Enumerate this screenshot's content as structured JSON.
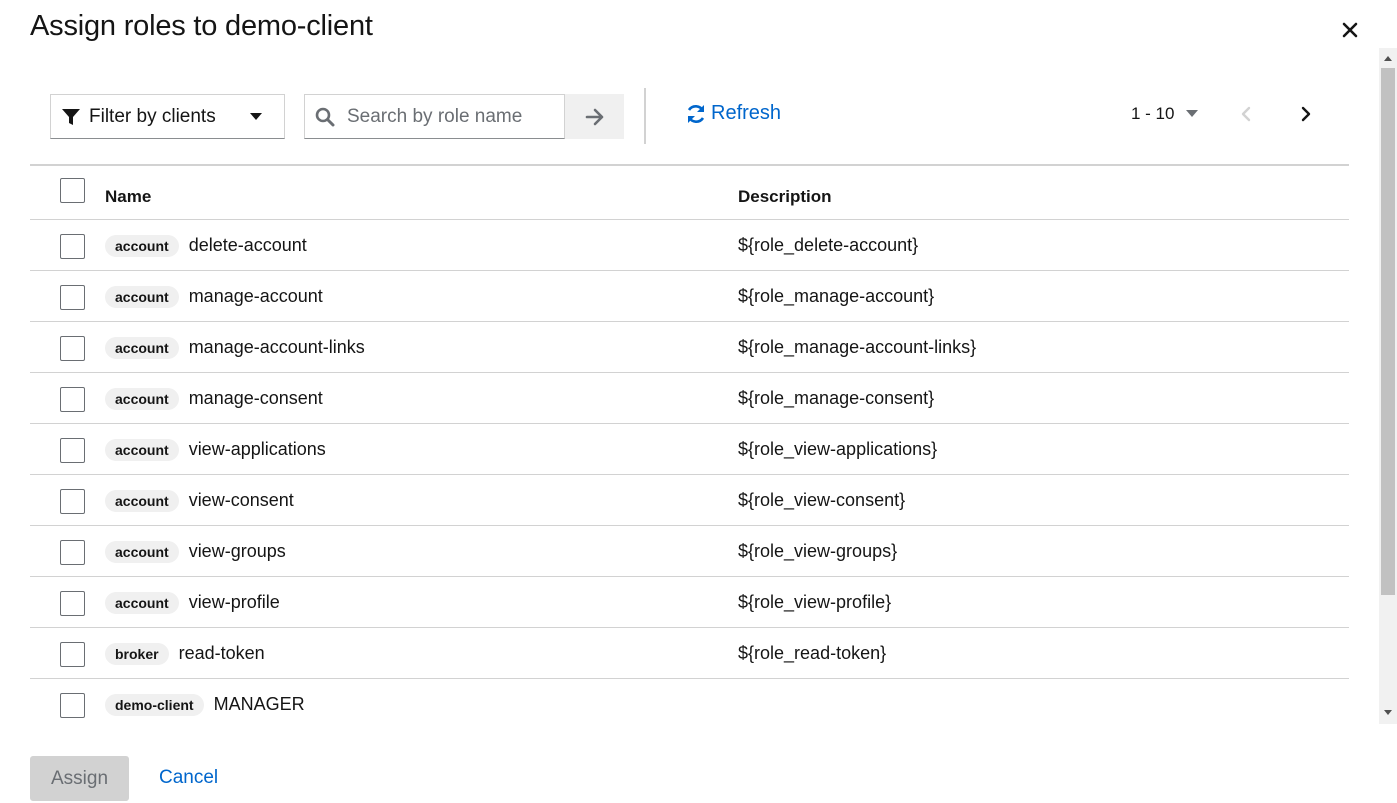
{
  "modal": {
    "title": "Assign roles to demo-client",
    "close_icon": "close-icon"
  },
  "toolbar": {
    "filter_label": "Filter by clients",
    "search_placeholder": "Search by role name",
    "refresh_label": "Refresh",
    "pagination_range": "1 - 10"
  },
  "table": {
    "headers": {
      "name": "Name",
      "description": "Description"
    },
    "rows": [
      {
        "badge": "account",
        "name": "delete-account",
        "description": "${role_delete-account}"
      },
      {
        "badge": "account",
        "name": "manage-account",
        "description": "${role_manage-account}"
      },
      {
        "badge": "account",
        "name": "manage-account-links",
        "description": "${role_manage-account-links}"
      },
      {
        "badge": "account",
        "name": "manage-consent",
        "description": "${role_manage-consent}"
      },
      {
        "badge": "account",
        "name": "view-applications",
        "description": "${role_view-applications}"
      },
      {
        "badge": "account",
        "name": "view-consent",
        "description": "${role_view-consent}"
      },
      {
        "badge": "account",
        "name": "view-groups",
        "description": "${role_view-groups}"
      },
      {
        "badge": "account",
        "name": "view-profile",
        "description": "${role_view-profile}"
      },
      {
        "badge": "broker",
        "name": "read-token",
        "description": "${role_read-token}"
      },
      {
        "badge": "demo-client",
        "name": "MANAGER",
        "description": ""
      }
    ]
  },
  "footer": {
    "assign_label": "Assign",
    "cancel_label": "Cancel"
  },
  "colors": {
    "link": "#0066cc",
    "border": "#d2d2d2",
    "badge_bg": "#f0f0f0",
    "disabled_bg": "#d2d2d2"
  }
}
